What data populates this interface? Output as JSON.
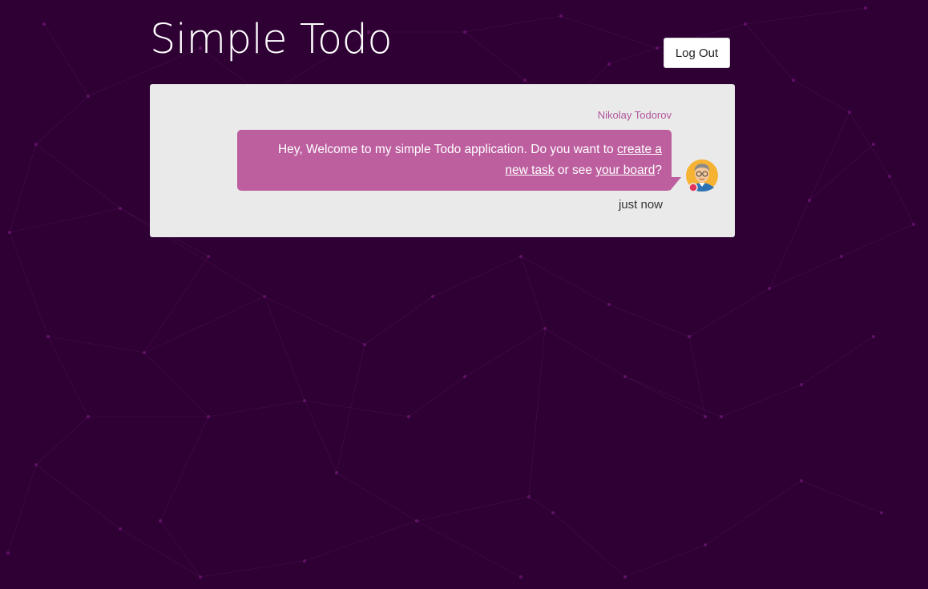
{
  "header": {
    "title": "Simple Todo",
    "logout_label": "Log Out"
  },
  "chat": {
    "sender": "Nikolay Todorov",
    "message": {
      "text_before": "Hey, Welcome to my simple Todo application. Do you want to ",
      "link_create": "create a new task",
      "text_middle": " or see ",
      "link_board": "your board",
      "text_after": "?"
    },
    "timestamp": "just now",
    "avatar_icon": "user-avatar-icon",
    "status_color": "#e2345b"
  },
  "colors": {
    "background": "#2e0033",
    "panel": "#eaeaea",
    "bubble": "#bd5e9f",
    "sender_name": "#b0559c"
  }
}
